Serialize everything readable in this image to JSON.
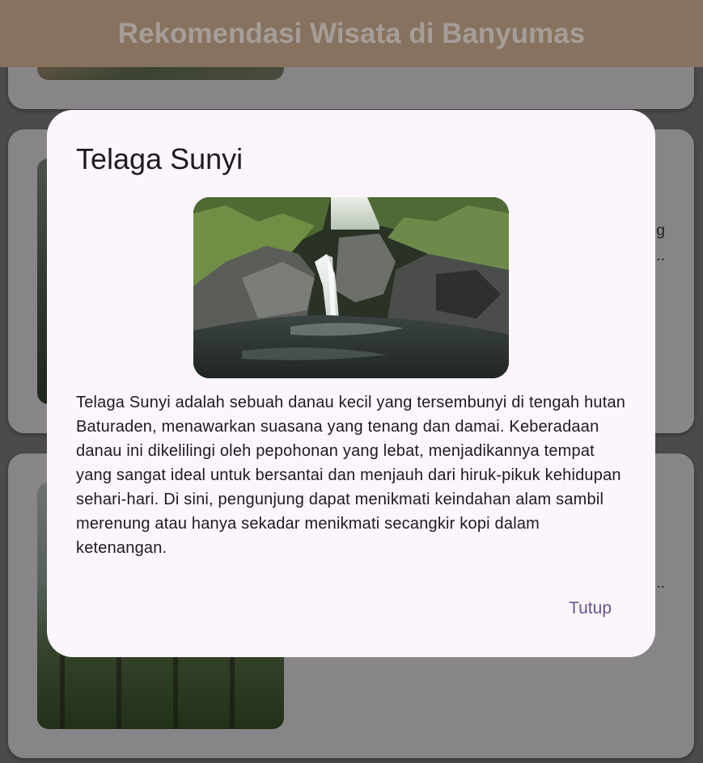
{
  "appbar": {
    "title": "Rekomendasi Wisata di Banyumas"
  },
  "background_cards": [
    {
      "text_fragments": [
        "g",
        "..."
      ]
    },
    {
      "text_fragments": [
        "..."
      ]
    }
  ],
  "dialog": {
    "title": "Telaga Sunyi",
    "image_alt": "Air terjun dan danau Telaga Sunyi",
    "description": "Telaga Sunyi adalah sebuah danau kecil yang tersembunyi di tengah hutan Baturaden, menawarkan suasana yang tenang dan damai. Keberadaan danau ini dikelilingi oleh pepohonan yang lebat, menjadikannya tempat yang sangat ideal untuk bersantai dan menjauh dari hiruk-pikuk kehidupan sehari-hari. Di sini, pengunjung dapat menikmati keindahan alam sambil merenung atau hanya sekadar menikmati secangkir kopi dalam ketenangan.",
    "close_label": "Tutup"
  },
  "colors": {
    "appbar": "#87725f",
    "dialog_bg": "#fdf5fc",
    "accent": "#67548e"
  }
}
